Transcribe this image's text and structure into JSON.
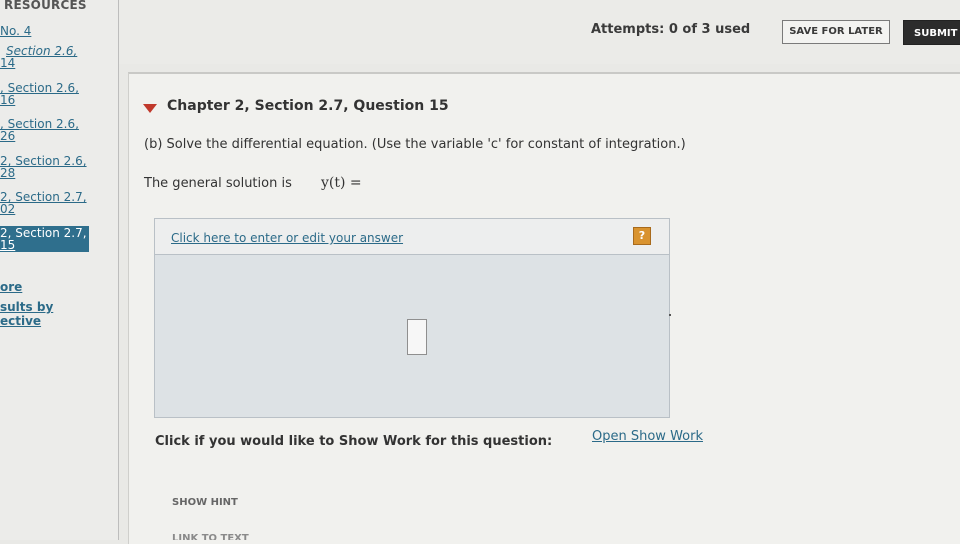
{
  "sidebar": {
    "title": "RESOURCES",
    "items": [
      {
        "line1": "No. 4",
        "line2": ""
      },
      {
        "line1": "Section 2.6,",
        "line2": "14"
      },
      {
        "line1": ", Section 2.6,",
        "line2": "16"
      },
      {
        "line1": ", Section 2.6,",
        "line2": "26"
      },
      {
        "line1": "2, Section 2.6,",
        "line2": "28"
      },
      {
        "line1": "2, Section 2.7,",
        "line2": "02"
      },
      {
        "line1": "2, Section 2.7,",
        "line2": "15"
      }
    ],
    "more": "ore",
    "results_line1": "sults by",
    "results_line2": "ective"
  },
  "topbar": {
    "attempts": "Attempts: 0 of 3 used",
    "save_label": "SAVE FOR LATER",
    "submit_label": "SUBMIT"
  },
  "question": {
    "title": "Chapter 2, Section 2.7, Question 15",
    "instruction": "(b) Solve the differential equation. (Use the variable 'c' for constant of integration.)",
    "general_text": "The general solution is",
    "general_var": "y(t) ="
  },
  "answer": {
    "link": "Click here to enter or edit your answer",
    "help_symbol": "?"
  },
  "show_work": {
    "label": "Click if you would like to Show Work for this question:",
    "link": "Open Show Work"
  },
  "hint": {
    "label": "SHOW HINT",
    "next_label": "LINK TO TEXT"
  },
  "colors": {
    "link": "#2b6a88",
    "active_nav": "#2f6f8d",
    "triangle": "#c0392b",
    "help": "#d9932f"
  }
}
